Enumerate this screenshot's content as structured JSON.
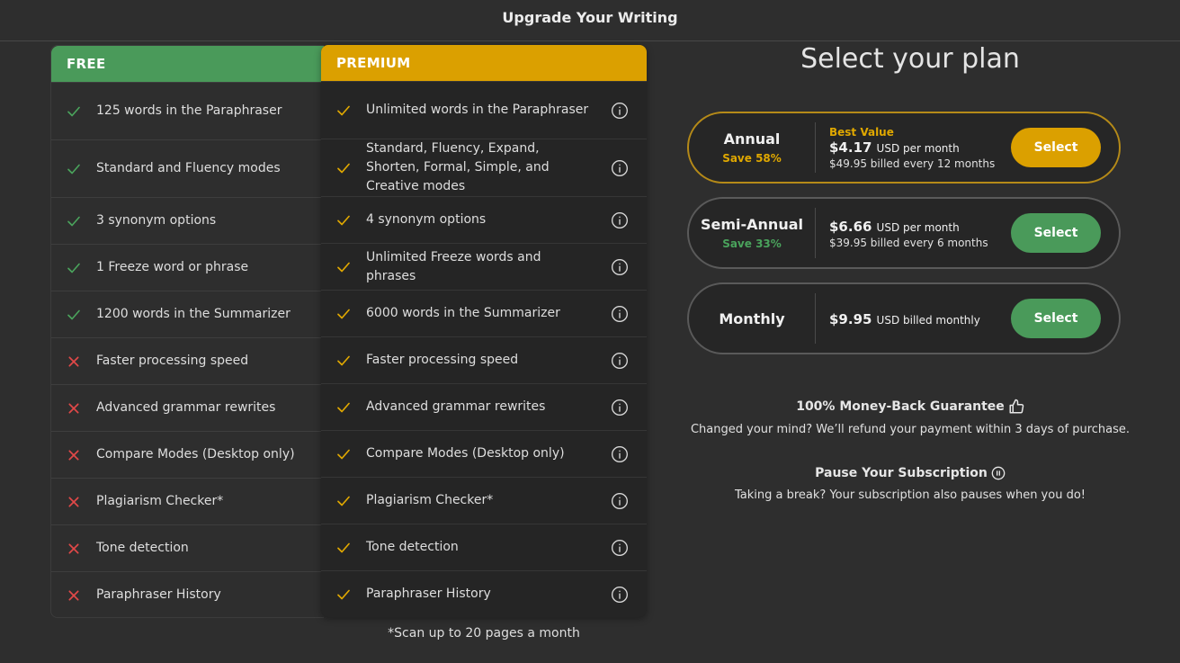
{
  "header": {
    "title": "Upgrade Your Writing"
  },
  "colors": {
    "free": "#4a9a5a",
    "premium": "#dba000",
    "check_free": "#4aa35c",
    "cross": "#e04848",
    "check_premium": "#e0a800"
  },
  "free": {
    "label": "FREE",
    "features": [
      {
        "text": "125 words in the Paraphraser",
        "included": true
      },
      {
        "text": "Standard and Fluency modes",
        "included": true
      },
      {
        "text": "3 synonym options",
        "included": true
      },
      {
        "text": "1 Freeze word or phrase",
        "included": true
      },
      {
        "text": "1200 words in the Summarizer",
        "included": true
      },
      {
        "text": "Faster processing speed",
        "included": false
      },
      {
        "text": "Advanced grammar rewrites",
        "included": false
      },
      {
        "text": "Compare Modes (Desktop only)",
        "included": false
      },
      {
        "text": "Plagiarism Checker*",
        "included": false
      },
      {
        "text": "Tone detection",
        "included": false
      },
      {
        "text": "Paraphraser History",
        "included": false
      }
    ]
  },
  "premium": {
    "label": "PREMIUM",
    "features": [
      {
        "text": "Unlimited words in the Paraphraser"
      },
      {
        "text": "Standard, Fluency, Expand, Shorten, Formal, Simple, and Creative modes"
      },
      {
        "text": "4 synonym options"
      },
      {
        "text": "Unlimited Freeze words and phrases"
      },
      {
        "text": "6000 words in the Summarizer"
      },
      {
        "text": "Faster processing speed"
      },
      {
        "text": "Advanced grammar rewrites"
      },
      {
        "text": "Compare Modes (Desktop only)"
      },
      {
        "text": "Plagiarism Checker*"
      },
      {
        "text": "Tone detection"
      },
      {
        "text": "Paraphraser History"
      }
    ]
  },
  "footnote": "*Scan up to 20 pages a month",
  "plans": {
    "title": "Select your plan",
    "options": [
      {
        "name": "Annual",
        "save": "Save 58%",
        "badge": "Best Value",
        "price": "$4.17",
        "per": "USD per month",
        "billed": "$49.95 billed every 12 months",
        "button": "Select",
        "accent": "#dba000"
      },
      {
        "name": "Semi-Annual",
        "save": "Save 33%",
        "badge": "",
        "price": "$6.66",
        "per": "USD per month",
        "billed": "$39.95 billed every 6 months",
        "button": "Select",
        "accent": "#4a9a5a"
      },
      {
        "name": "Monthly",
        "save": "",
        "badge": "",
        "price": "$9.95",
        "per": "USD billed monthly",
        "billed": "",
        "button": "Select",
        "accent": "#4a9a5a"
      }
    ]
  },
  "guarantee": {
    "title": "100% Money-Back Guarantee",
    "text": "Changed your mind? We’ll refund your payment within 3 days of purchase.",
    "icon": "thumbs-up-icon"
  },
  "pause": {
    "title": "Pause Your Subscription",
    "text": "Taking a break? Your subscription also pauses when you do!",
    "icon": "pause-circle-icon"
  }
}
